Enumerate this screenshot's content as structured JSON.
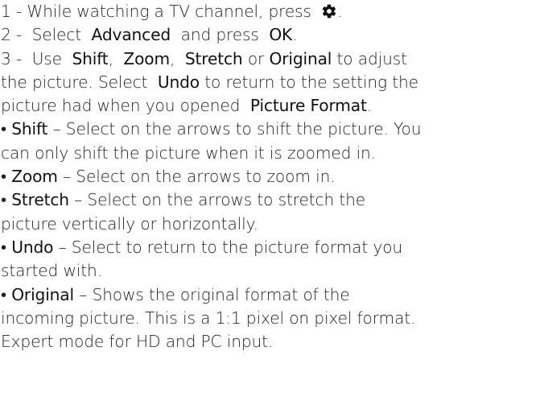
{
  "steps": {
    "step1": {
      "text": "1 -  While watching a TV channel, press ",
      "end": ".",
      "icon": "gear-icon"
    },
    "step2": {
      "prefix": "2 -  Select  ",
      "advanced": "Advanced",
      "mid": "  and press  ",
      "ok": "OK",
      "end": "."
    },
    "step3": {
      "prefix": "3 -  Use  ",
      "shift": "Shift",
      "sep1": ",  ",
      "zoom": "Zoom",
      "sep2": ",  ",
      "stretch": "Stretch",
      "or": " or ",
      "original": "Original",
      "tail": " to adjust",
      "line2_a": "the picture. Select  ",
      "undo": "Undo",
      "line2_b": " to return to the setting the",
      "line3_a": "picture had when you opened  ",
      "picture_format": "Picture Format",
      "line3_end": "."
    }
  },
  "bullets": {
    "shift": {
      "dot": "• ",
      "term": "Shift",
      "line1": " – Select on the arrows to shift the picture. You",
      "line2": "can only shift the picture when it is zoomed in."
    },
    "zoom": {
      "dot": "• ",
      "term": "Zoom",
      "line1": " – Select on the arrows to zoom in."
    },
    "stretch": {
      "dot": "• ",
      "term": "Stretch",
      "line1": " – Select on the arrows to stretch the",
      "line2": "picture vertically or horizontally."
    },
    "undo": {
      "dot": "• ",
      "term": "Undo",
      "line1": " – Select to return to the picture format you",
      "line2": "started with."
    },
    "original": {
      "dot": "• ",
      "term": "Original",
      "line1": " – Shows the original format of the",
      "line2": "incoming picture. This is a 1:1 pixel on pixel format.",
      "line3": "Expert mode for HD and PC input."
    }
  }
}
